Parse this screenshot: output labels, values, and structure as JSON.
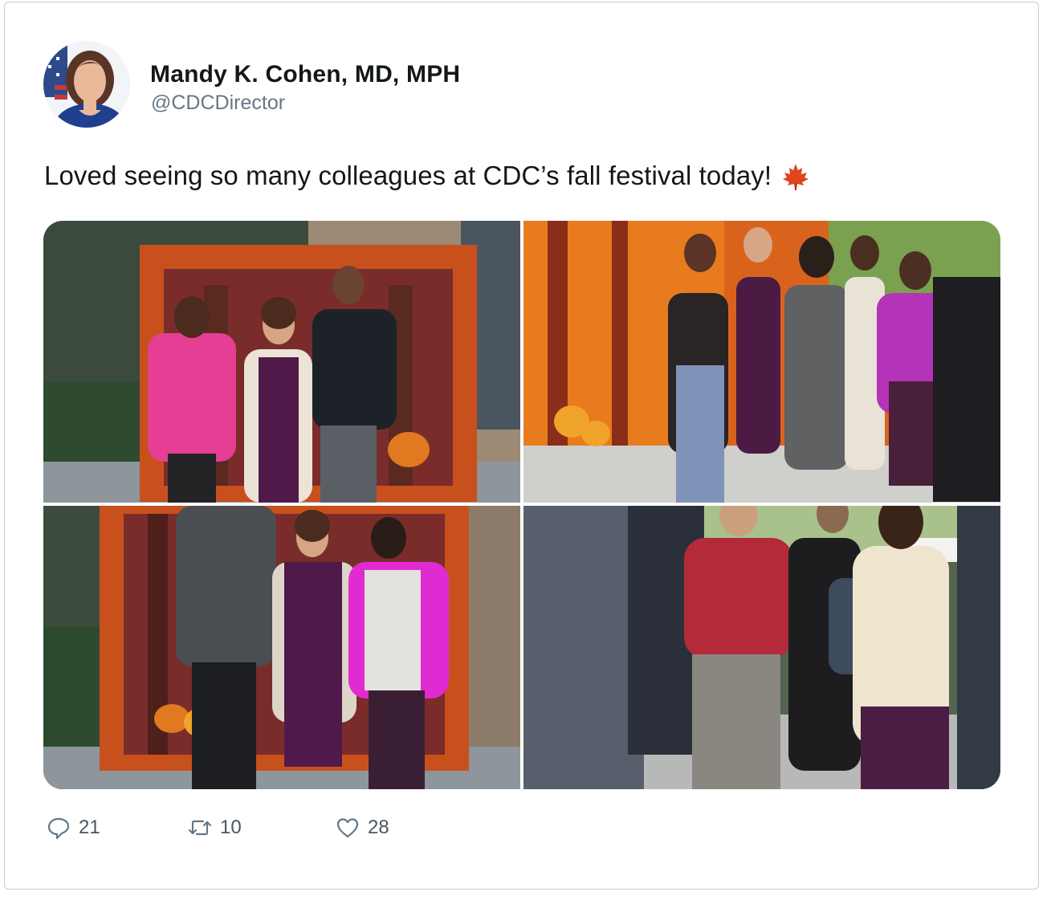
{
  "tweet": {
    "author_name": "Mandy K. Cohen, MD, MPH",
    "author_handle": "@CDCDirector",
    "text": "Loved seeing so many colleagues at CDC’s fall festival today!",
    "emoji": "maple-leaf-icon"
  },
  "media": {
    "photos": [
      {
        "name": "photo-1",
        "subject": "three people posing in front of autumn leaf backdrop"
      },
      {
        "name": "photo-2",
        "subject": "group of women posing in front of autumn forest backdrop"
      },
      {
        "name": "photo-3",
        "subject": "three people posing in front of autumn leaf backdrop"
      },
      {
        "name": "photo-4",
        "subject": "colleagues talking outdoors"
      }
    ]
  },
  "actions": {
    "replies": "21",
    "retweets": "10",
    "likes": "28"
  },
  "colors": {
    "text_primary": "#14171a",
    "text_secondary": "#657786",
    "border": "#c9ccd1",
    "leaf": "#e0451f"
  }
}
